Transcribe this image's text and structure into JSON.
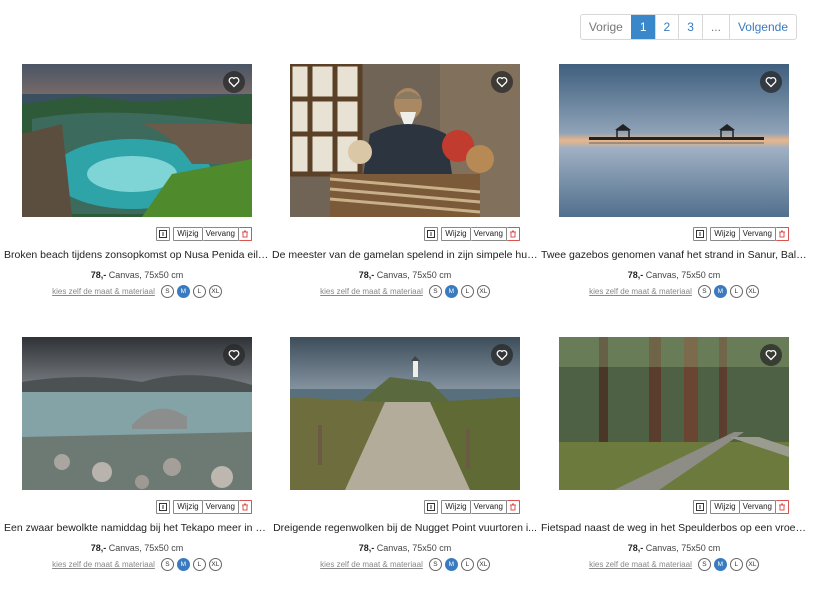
{
  "pagination": {
    "prev": "Vorige",
    "pages": [
      "1",
      "2",
      "3",
      "..."
    ],
    "next": "Volgende",
    "active": "1"
  },
  "actions": {
    "info": "i",
    "edit": "Wijzig",
    "replace": "Vervang"
  },
  "custom_link": "kies zelf de maat & materiaal",
  "sizes": [
    "S",
    "M",
    "L",
    "XL"
  ],
  "selected_size": "M",
  "products": [
    {
      "title": "Broken beach tijdens zonsopkomst op Nusa Penida eila...",
      "price": "78,-",
      "spec": "Canvas, 75x50 cm"
    },
    {
      "title": "De meester van de gamelan spelend in zijn simpele huis ...",
      "price": "78,-",
      "spec": "Canvas, 75x50 cm"
    },
    {
      "title": "Twee gazebos genomen vanaf het strand in Sanur, Bali v...",
      "price": "78,-",
      "spec": "Canvas, 75x50 cm"
    },
    {
      "title": "Een zwaar bewolkte namiddag bij het Tekapo meer in Ni...",
      "price": "78,-",
      "spec": "Canvas, 75x50 cm"
    },
    {
      "title": "Dreigende regenwolken bij de Nugget Point vuurtoren i...",
      "price": "78,-",
      "spec": "Canvas, 75x50 cm"
    },
    {
      "title": "Fietspad naast de weg in het Speulderbos op een vroeg...",
      "price": "78,-",
      "spec": "Canvas, 75x50 cm"
    }
  ]
}
